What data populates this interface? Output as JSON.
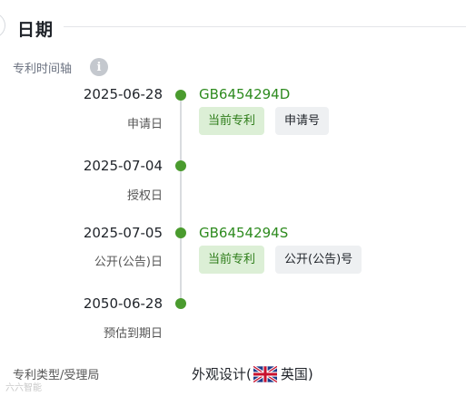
{
  "section": {
    "title": "日期"
  },
  "timeline": {
    "label": "专利时间轴",
    "info_icon": "info-icon",
    "entries": [
      {
        "date": "2025-06-28",
        "event": "申请日",
        "number": "GB6454294D",
        "tags": [
          "当前专利",
          "申请号"
        ]
      },
      {
        "date": "2025-07-04",
        "event": "授权日"
      },
      {
        "date": "2025-07-05",
        "event": "公开(公告)日",
        "number": "GB6454294S",
        "tags": [
          "当前专利",
          "公开(公告)号"
        ]
      },
      {
        "date": "2050-06-28",
        "event": "预估到期日"
      }
    ]
  },
  "patent_type": {
    "label": "专利类型/受理局",
    "type": "外观设计",
    "open_paren": "(",
    "office": "英国",
    "close_paren": ")",
    "flag_icon": "uk-flag-icon"
  },
  "watermark": "六六智能",
  "colors": {
    "accent_green": "#4a9b2e",
    "patent_number_green": "#2e8b1f",
    "current_tag_bg": "#dcefd6"
  }
}
